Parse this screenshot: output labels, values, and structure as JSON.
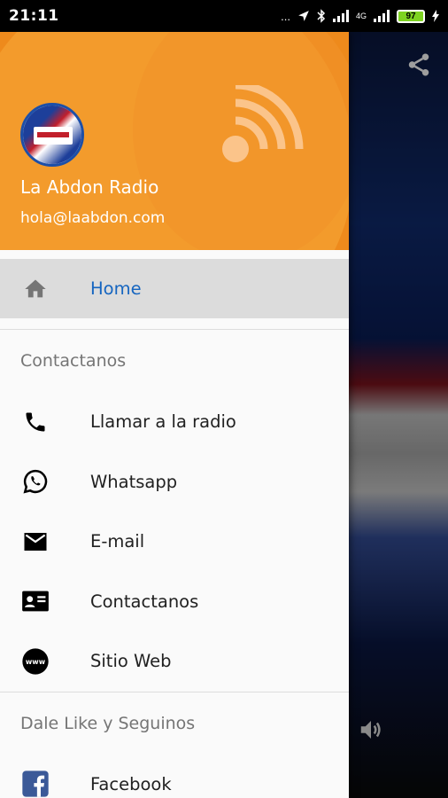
{
  "status_bar": {
    "time": "21:11",
    "indicators": "...",
    "network_label": "4G",
    "battery": "97"
  },
  "header": {
    "station_name": "La Abdon Radio",
    "email": "hola@laabdon.com"
  },
  "menu": {
    "home": "Home",
    "contact_section": "Contactanos",
    "contact_items": [
      {
        "label": "Llamar a la radio",
        "icon": "phone-icon"
      },
      {
        "label": "Whatsapp",
        "icon": "whatsapp-icon"
      },
      {
        "label": "E-mail",
        "icon": "mail-icon"
      },
      {
        "label": "Contactanos",
        "icon": "contact-card-icon"
      },
      {
        "label": "Sitio Web",
        "icon": "www-icon"
      }
    ],
    "social_section": "Dale Like y Seguinos",
    "social_items": [
      {
        "label": "Facebook",
        "icon": "facebook-icon"
      }
    ]
  },
  "colors": {
    "header_orange": "#ee8a1c",
    "active_text": "#1565c0",
    "active_bg": "#dcdcdc"
  }
}
